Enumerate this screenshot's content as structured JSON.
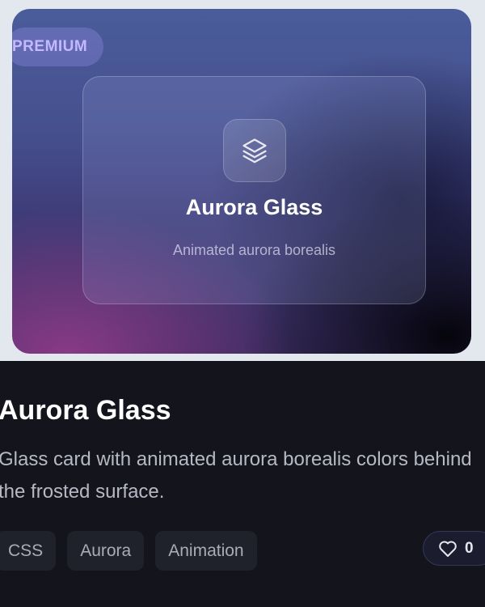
{
  "preview": {
    "badge": "PREMIUM",
    "card_title": "Aurora Glass",
    "card_subtitle": "Animated aurora borealis",
    "icon": "layers-icon"
  },
  "info": {
    "title": "Aurora Glass",
    "description": "Glass card with animated aurora borealis colors behind the frosted surface.",
    "tags": [
      "CSS",
      "Aurora",
      "Animation"
    ],
    "like_count": "0",
    "like_icon": "heart-icon"
  },
  "colors": {
    "badge_text": "#c4b8ff",
    "page_bg": "#13141c",
    "preview_bg": "#e3e7ee"
  }
}
